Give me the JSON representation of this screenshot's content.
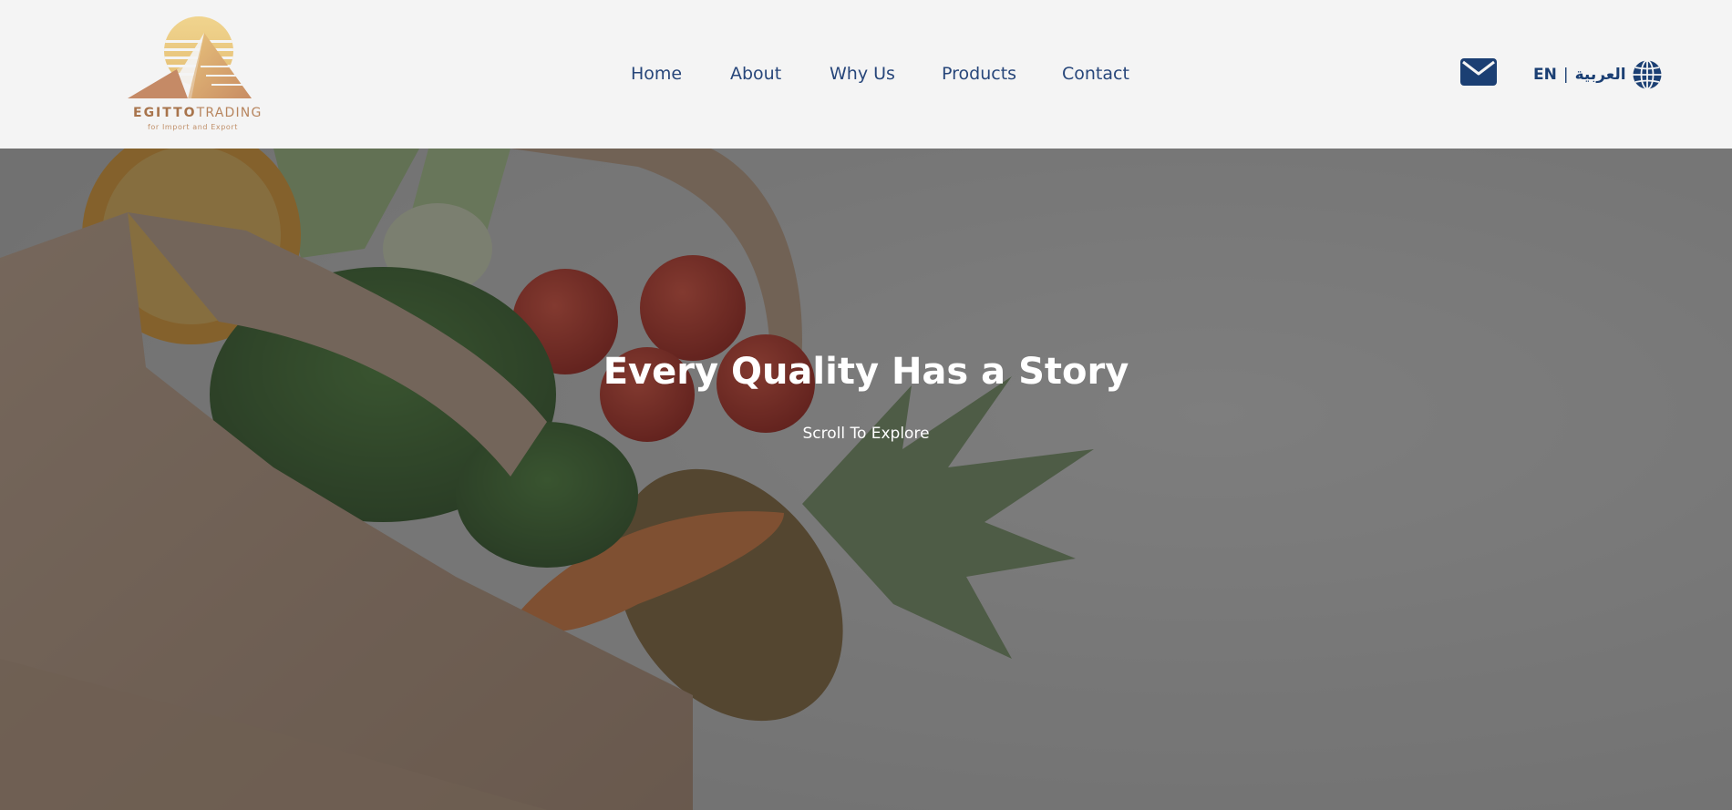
{
  "brand": {
    "logo_icon": "pyramid-sun-logo",
    "name_bold": "EGITTO",
    "name_light": "TRADING",
    "tagline": "for Import and Export",
    "colors": {
      "gold": "#e7c27a",
      "copper": "#c8946b"
    }
  },
  "nav": {
    "items": [
      {
        "label": "Home"
      },
      {
        "label": "About"
      },
      {
        "label": "Why Us"
      },
      {
        "label": "Products"
      },
      {
        "label": "Contact"
      }
    ],
    "color": "#27467a"
  },
  "header_actions": {
    "mail_icon": "envelope-icon",
    "lang_en": "EN",
    "lang_separator": "|",
    "lang_ar": "العربية",
    "globe_icon": "globe-icon",
    "color": "#1b3f73"
  },
  "hero": {
    "title": "Every Quality Has a Story",
    "subtitle": "Scroll To Explore",
    "background_image": "grocery-bag-with-vegetables-photo"
  }
}
